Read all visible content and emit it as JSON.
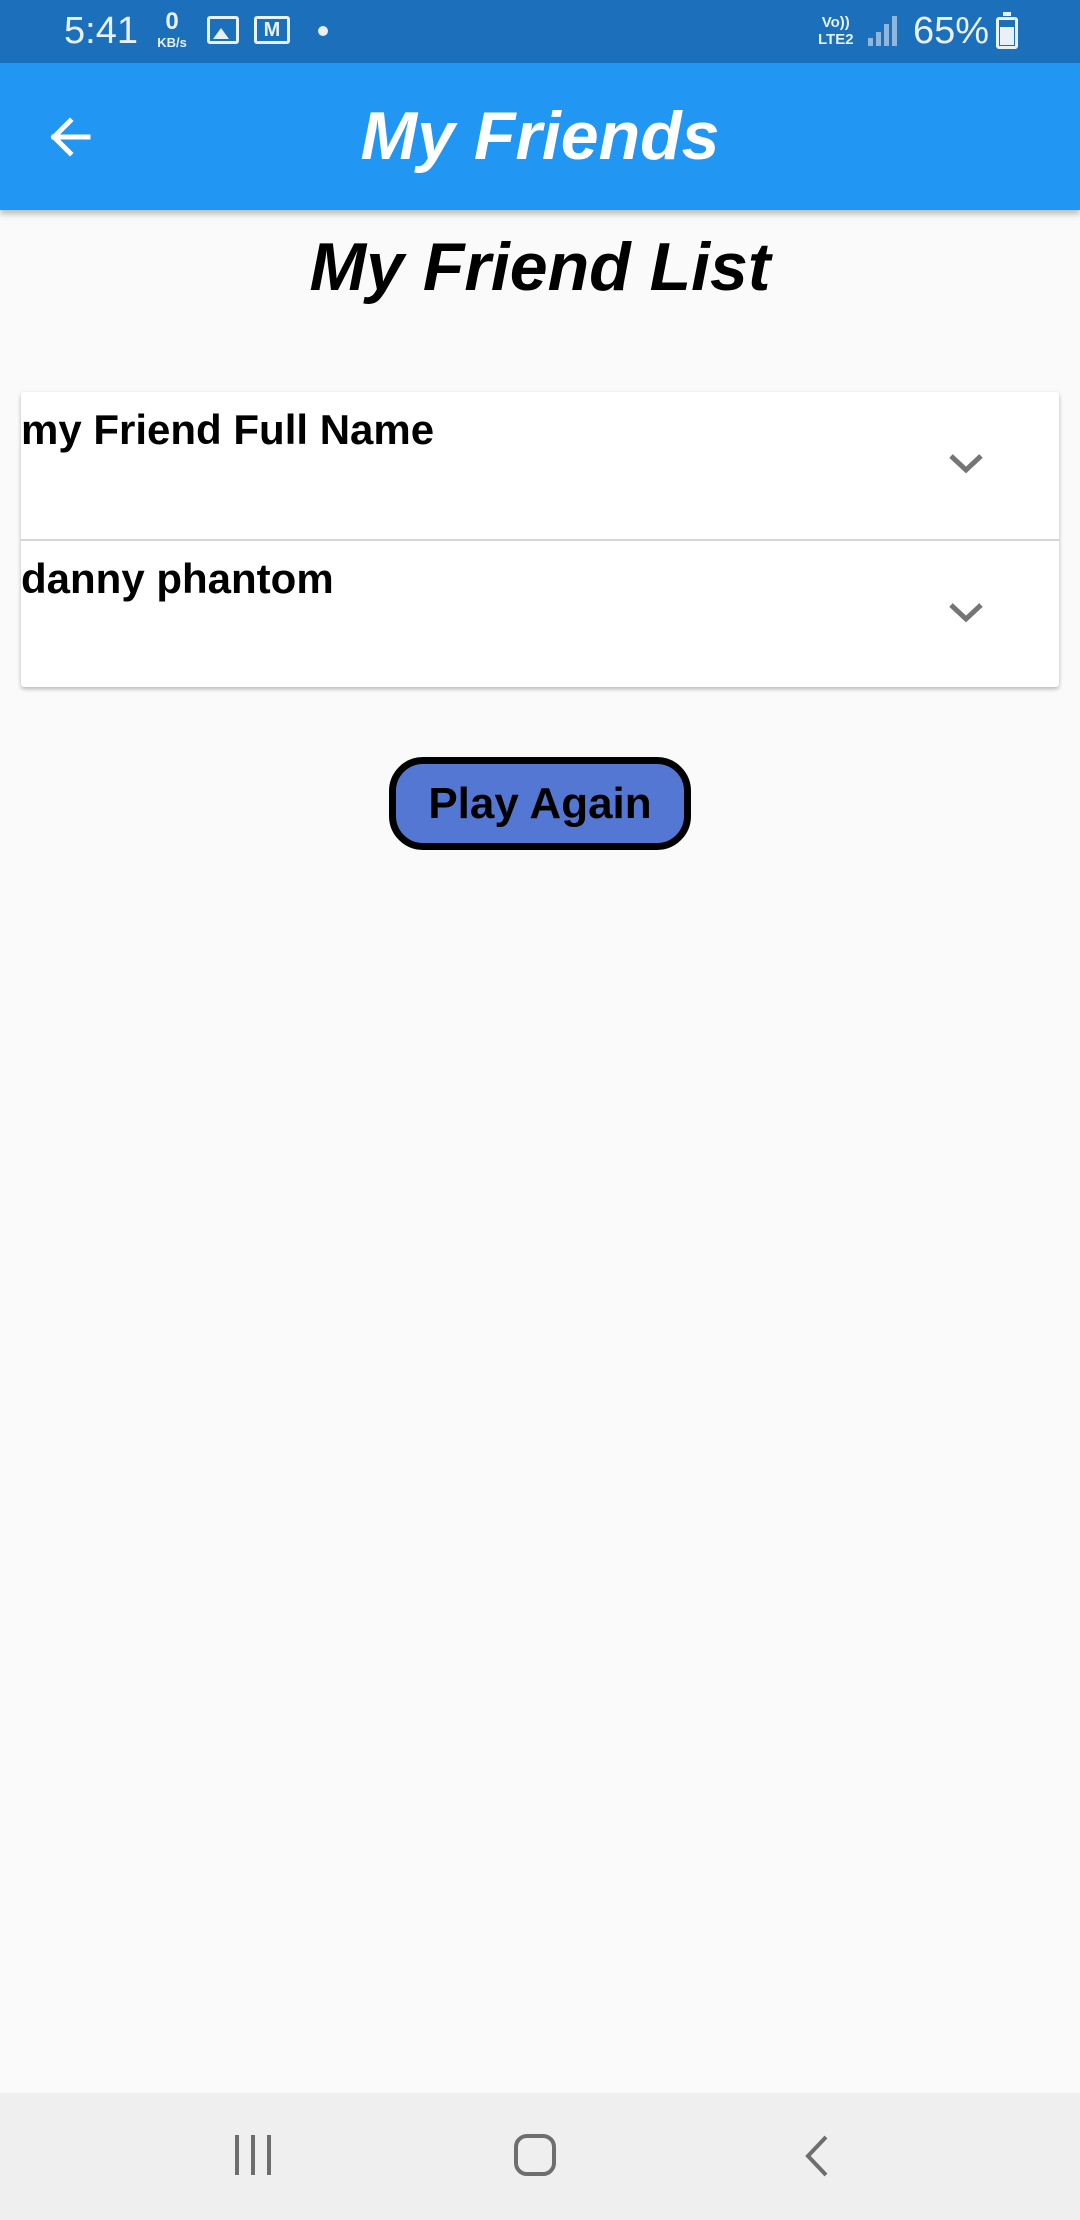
{
  "status_bar": {
    "time": "5:41",
    "net_speed_value": "0",
    "net_speed_unit": "KB/s",
    "volte_line1": "Vo))",
    "volte_line2": "LTE2",
    "battery": "65%"
  },
  "app_bar": {
    "title": "My Friends",
    "back_icon": "arrow-left-icon",
    "color": "#2196f3"
  },
  "page": {
    "heading": "My Friend List"
  },
  "friends": [
    {
      "name": "my Friend Full Name",
      "icon": "chevron-down-icon"
    },
    {
      "name": "danny phantom",
      "icon": "chevron-down-icon"
    }
  ],
  "actions": {
    "play_again_label": "Play Again",
    "play_again_color": "#5577d4"
  },
  "nav_bar": {
    "icons": [
      "recent-apps-icon",
      "home-icon",
      "back-icon"
    ]
  }
}
